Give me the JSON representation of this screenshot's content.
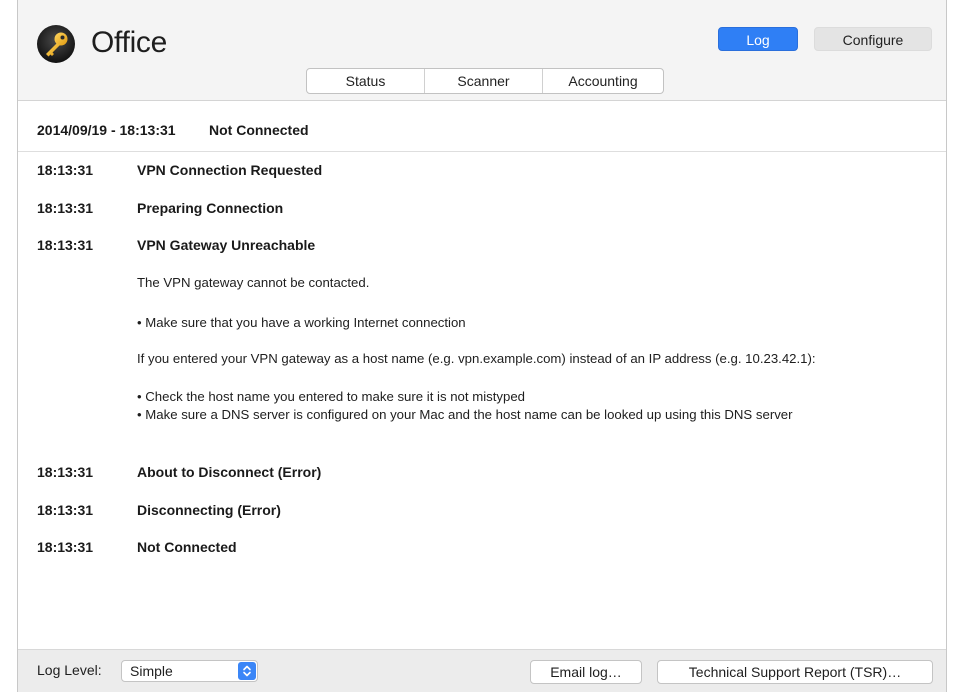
{
  "app": {
    "title": "Office",
    "icon": "key-icon",
    "accent_color": "#2f7ff5"
  },
  "top_buttons": {
    "log_label": "Log",
    "configure_label": "Configure",
    "active": "Log"
  },
  "tabs": [
    {
      "label": "Status"
    },
    {
      "label": "Scanner"
    },
    {
      "label": "Accounting"
    }
  ],
  "header": {
    "datetime": "2014/09/19 - 18:13:31",
    "status": "Not Connected"
  },
  "log": {
    "entries": [
      {
        "time": "18:13:31",
        "title": "VPN Connection Requested"
      },
      {
        "time": "18:13:31",
        "title": "Preparing Connection"
      },
      {
        "time": "18:13:31",
        "title": "VPN Gateway Unreachable"
      },
      {
        "time": "18:13:31",
        "title": "About to Disconnect (Error)"
      },
      {
        "time": "18:13:31",
        "title": "Disconnecting (Error)"
      },
      {
        "time": "18:13:31",
        "title": "Not Connected"
      }
    ],
    "details": {
      "line1": "The VPN gateway cannot be contacted.",
      "bullet1": "Make sure that you have a working Internet connection",
      "line2": "If you entered your VPN gateway as a host name (e.g. vpn.example.com) instead of an IP address (e.g. 10.23.42.1):",
      "bullet2": "Check the host name you entered to make sure it is not mistyped",
      "bullet3": "Make sure a DNS server is configured on your Mac and the host name can be looked up using this DNS server"
    }
  },
  "bottom": {
    "log_level_label": "Log Level:",
    "log_level_value": "Simple",
    "email_label": "Email log…",
    "tsr_label": "Technical Support Report (TSR)…"
  }
}
